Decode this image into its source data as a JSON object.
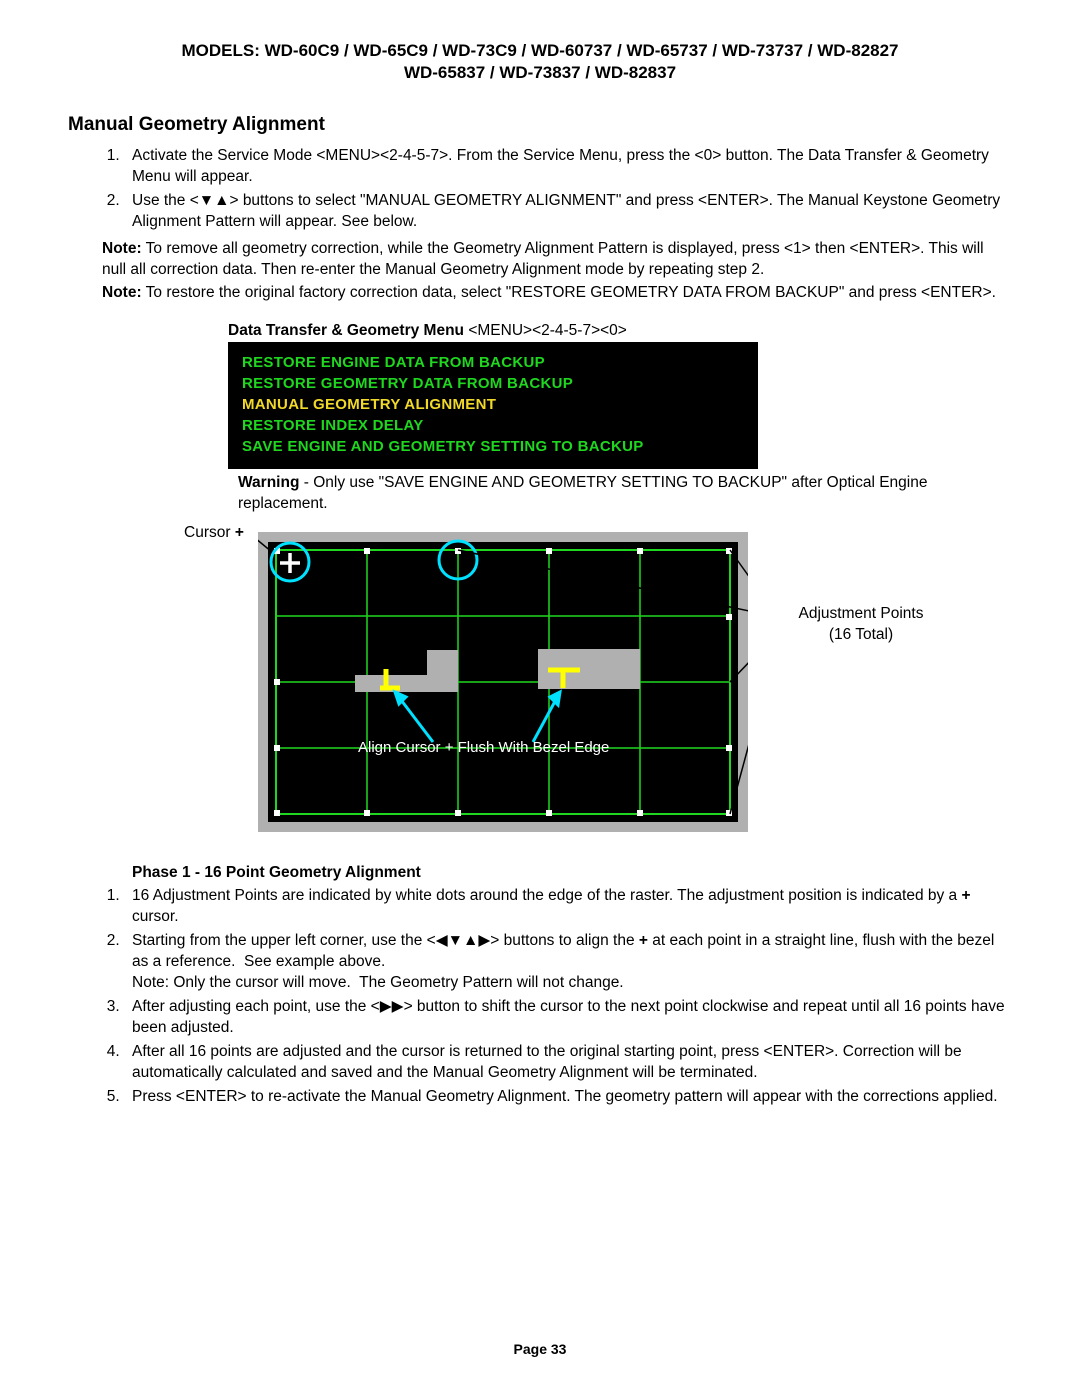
{
  "header": {
    "line1": "MODELS: WD-60C9 / WD-65C9 / WD-73C9 / WD-60737 / WD-65737 / WD-73737 / WD-82827",
    "line2": "WD-65837 / WD-73837 / WD-82837"
  },
  "section_title": "Manual Geometry Alignment",
  "intro_steps": [
    "Activate the Service Mode <MENU><2-4-5-7>.  From the Service Menu, press the <0> button. The Data Transfer & Geometry Menu will appear.",
    "Use the <▼▲> buttons to select \"MANUAL GEOMETRY ALIGNMENT\" and press <ENTER>. The Manual Keystone Geometry Alignment Pattern will appear. See below."
  ],
  "note1_label": "Note:",
  "note1": "To remove all geometry correction,  while the Geometry Alignment Pattern is displayed, press <1> then <ENTER>.  This will null all correction data.  Then re-enter the Manual Geometry Alignment mode by repeating step 2.",
  "note2_label": "Note:",
  "note2": "To restore the original factory correction data, select \"RESTORE GEOMETRY DATA FROM BACKUP\" and press <ENTER>.",
  "menu_caption_bold": "Data Transfer & Geometry Menu",
  "menu_caption_rest": " <MENU><2-4-5-7><0>",
  "menu_items": {
    "i0": "RESTORE ENGINE DATA FROM BACKUP",
    "i1": "RESTORE GEOMETRY DATA FROM BACKUP",
    "i2": "MANUAL GEOMETRY ALIGNMENT",
    "i3": "RESTORE INDEX DELAY",
    "i4": "SAVE ENGINE AND GEOMETRY SETTING TO BACKUP"
  },
  "warning_bold": "Warning",
  "warning_text": " - Only use \"SAVE ENGINE AND GEOMETRY SETTING TO BACKUP\" after Optical Engine replacement.",
  "figure": {
    "cursor_label": "Cursor",
    "cursor_plus": "+",
    "adj_label_l1": "Adjustment Points",
    "adj_label_l2": "(16 Total)",
    "caption": "Align Cursor + Flush With Bezel Edge"
  },
  "phase_title": "Phase 1 - 16 Point Geometry Alignment",
  "phase_steps": [
    "16 Adjustment Points are indicated by white dots around the edge of the raster. The adjustment position is indicated by a + cursor.",
    "Starting from the upper left corner, use the <◀▼▲▶> buttons to align the + at each point in a straight line, flush with the bezel as a reference.  See example above.\nNote: Only the cursor will move.  The Geometry Pattern will not change.",
    "After adjusting each point, use the <▶▶> button to shift the cursor to the next point clockwise and repeat until all 16 points have been adjusted.",
    "After all 16 points are adjusted and the cursor is returned to the original starting point, press <ENTER>. Correction will be automatically calculated and saved and the Manual Geometry Alignment will be terminated.",
    "Press <ENTER> to re-activate the Manual Geometry Alignment. The geometry pattern will appear with the corrections applied."
  ],
  "footer": "Page 33"
}
